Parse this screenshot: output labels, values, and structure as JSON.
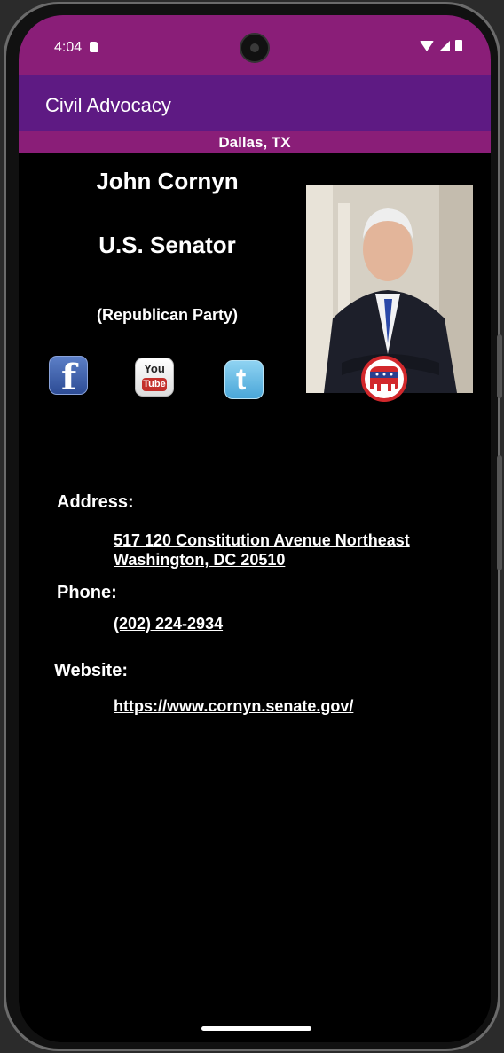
{
  "status_bar": {
    "time": "4:04"
  },
  "app_bar": {
    "title": "Civil Advocacy"
  },
  "location": "Dallas, TX",
  "official": {
    "name": "John Cornyn",
    "office": "U.S. Senator",
    "party": "(Republican Party)"
  },
  "social": {
    "facebook_glyph": "f",
    "youtube_you": "You",
    "youtube_tube": "Tube",
    "twitter_glyph": "t"
  },
  "contact": {
    "address_label": "Address:",
    "address_line1": "517 120 Constitution Avenue Northeast",
    "address_line2": "Washington, DC 20510",
    "phone_label": "Phone:",
    "phone": "(202) 224-2934",
    "website_label": "Website:",
    "website": "https://www.cornyn.senate.gov/"
  },
  "colors": {
    "status_bar": "#8a1e78",
    "app_bar": "#5e1a83",
    "background": "#000000",
    "republican_red": "#d2282c"
  },
  "icons": [
    "facebook-icon",
    "youtube-icon",
    "twitter-icon",
    "republican-party-icon",
    "wifi-icon",
    "signal-icon",
    "battery-icon",
    "sd-card-icon"
  ]
}
